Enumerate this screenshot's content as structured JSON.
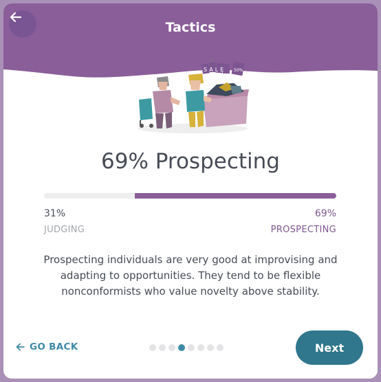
{
  "header": {
    "title": "Tactics",
    "back_icon": "arrow-left-icon",
    "color": "#8a5e99"
  },
  "illustration": {
    "tags": [
      "SALE",
      "50%"
    ]
  },
  "result": {
    "headline": "69% Prospecting",
    "prospecting_fraction": 0.69,
    "left_percent": "31%",
    "left_label": "JUDGING",
    "right_percent": "69%",
    "right_label": "PROSPECTING"
  },
  "description": "Prospecting individuals are very good at improvising and adapting to opportunities. They tend to be flexible nonconformists who value novelty above stability.",
  "footer": {
    "go_back_label": "GO BACK",
    "next_label": "Next",
    "page_count": 8,
    "active_page": 4
  },
  "colors": {
    "accent_purple": "#8a5e99",
    "accent_teal": "#30768c",
    "text_dark": "#474b55"
  }
}
